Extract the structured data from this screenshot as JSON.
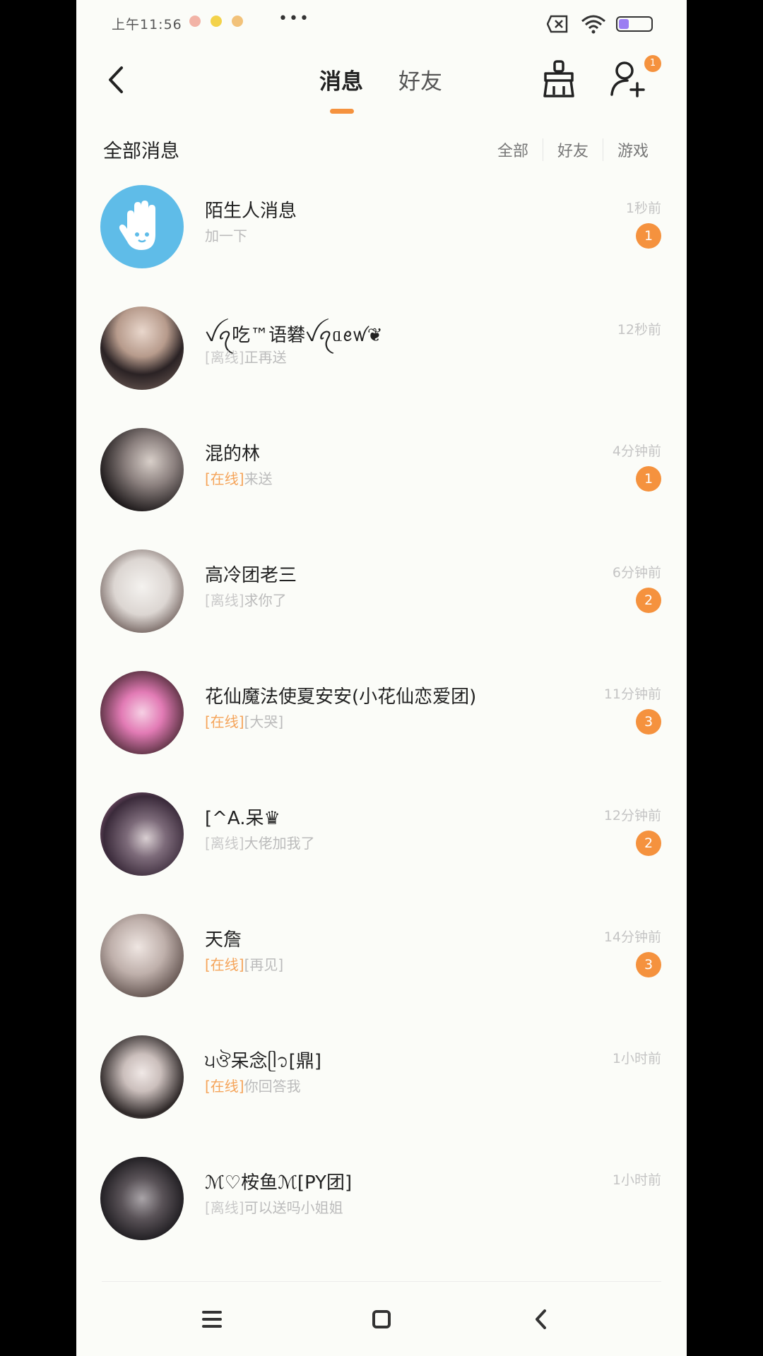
{
  "status_bar": {
    "time": "上午11:56",
    "more": "•••"
  },
  "header": {
    "tab_messages": "消息",
    "tab_friends": "好友",
    "add_friend_badge": "1"
  },
  "section": {
    "title": "全部消息",
    "filters": [
      "全部",
      "好友",
      "游戏"
    ]
  },
  "conversations": [
    {
      "name": "陌生人消息",
      "status": "",
      "message": "加一下",
      "time": "1秒前",
      "unread": "1"
    },
    {
      "name": "ꪜꪖ吃™语礬ꪜꪖᥲꫀꪝ❦",
      "status": "[离线]",
      "message": "正再送",
      "time": "12秒前",
      "unread": ""
    },
    {
      "name": "混的林",
      "status": "[在线]",
      "message": "来送",
      "time": "4分钟前",
      "unread": "1"
    },
    {
      "name": "高冷团老三",
      "status": "[离线]",
      "message": "求你了",
      "time": "6分钟前",
      "unread": "2"
    },
    {
      "name": "花仙魔法使夏安安(小花仙恋爱团)",
      "status": "[在线]",
      "message": "[大哭]",
      "time": "11分钟前",
      "unread": "3"
    },
    {
      "name": "[^A.呆♛",
      "status": "[离线]",
      "message": "大佬加我了",
      "time": "12分钟前",
      "unread": "2"
    },
    {
      "name": "天詹",
      "status": "[在线]",
      "message": "[再见]",
      "time": "14分钟前",
      "unread": "3"
    },
    {
      "name": "੫ঔ呆念ᥫ᭡[鼎]",
      "status": "[在线]",
      "message": "你回答我",
      "time": "1小时前",
      "unread": ""
    },
    {
      "name": "ℳ♡桉鱼ℳ[PY团]",
      "status": "[离线]",
      "message": "可以送吗小姐姐",
      "time": "1小时前",
      "unread": ""
    }
  ],
  "icons": {
    "back": "chevron-left-icon",
    "clean": "broom-icon",
    "add_friend": "add-user-icon",
    "nav_menu": "menu-icon",
    "nav_home": "home-square-icon",
    "nav_back": "back-arrow-icon"
  },
  "colors": {
    "accent": "#f5923e",
    "online": "#f5a45a",
    "bg": "#fbfcf8"
  }
}
